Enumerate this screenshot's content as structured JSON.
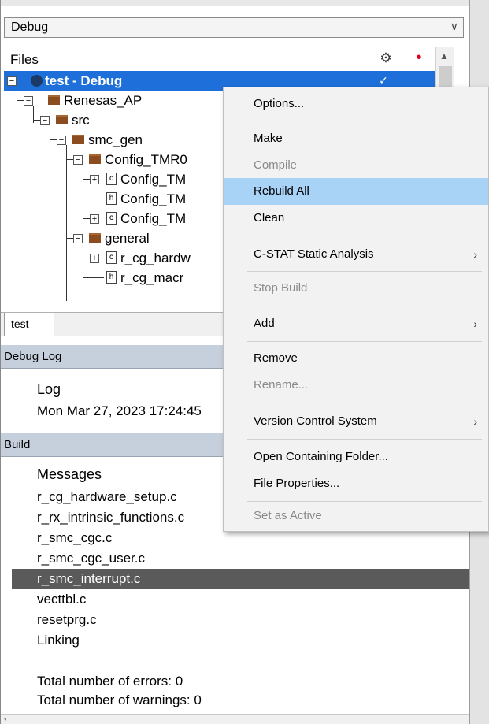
{
  "config": {
    "selected": "Debug",
    "arrow_icon": "chevron-down-icon"
  },
  "workspace": {
    "files_label": "Files",
    "tree": [
      {
        "label": "test - Debug",
        "kind": "project",
        "check": "✓"
      },
      {
        "label": "Renesas_AP",
        "kind": "folder"
      },
      {
        "label": "src",
        "kind": "folder"
      },
      {
        "label": "smc_gen",
        "kind": "folder"
      },
      {
        "label": "Config_TMR0",
        "kind": "folder"
      },
      {
        "label": "Config_TM",
        "kind": "file"
      },
      {
        "label": "Config_TM",
        "kind": "file"
      },
      {
        "label": "Config_TM",
        "kind": "file"
      },
      {
        "label": "general",
        "kind": "folder"
      },
      {
        "label": "r_cg_hardw",
        "kind": "file"
      },
      {
        "label": "r_cg_macr",
        "kind": "file"
      }
    ],
    "tab_label": "test"
  },
  "debug_log": {
    "title": "Debug Log",
    "header": "Log",
    "entries": [
      "Mon Mar 27, 2023 17:24:45"
    ]
  },
  "build": {
    "title": "Build",
    "header": "Messages",
    "messages": [
      "r_cg_hardware_setup.c",
      "r_rx_intrinsic_functions.c",
      "r_smc_cgc.c",
      "r_smc_cgc_user.c",
      "r_smc_interrupt.c",
      "vecttbl.c",
      "resetprg.c",
      "Linking",
      "",
      "Total number of errors: 0",
      "Total number of warnings: 0"
    ],
    "highlighted_index": 4
  },
  "context_menu": {
    "items": [
      {
        "label": "Options...",
        "state": "normal"
      },
      {
        "label": "Make",
        "state": "normal"
      },
      {
        "label": "Compile",
        "state": "disabled"
      },
      {
        "label": "Rebuild All",
        "state": "highlighted"
      },
      {
        "label": "Clean",
        "state": "normal"
      },
      {
        "label": "C-STAT Static Analysis",
        "state": "normal",
        "submenu": true
      },
      {
        "label": "Stop Build",
        "state": "disabled"
      },
      {
        "label": "Add",
        "state": "normal",
        "submenu": true
      },
      {
        "label": "Remove",
        "state": "normal"
      },
      {
        "label": "Rename...",
        "state": "disabled"
      },
      {
        "label": "Version Control System",
        "state": "normal",
        "submenu": true
      },
      {
        "label": "Open Containing Folder...",
        "state": "normal"
      },
      {
        "label": "File Properties...",
        "state": "normal"
      },
      {
        "label": "Set as Active",
        "state": "disabled"
      }
    ],
    "submenu_glyph": "›"
  }
}
